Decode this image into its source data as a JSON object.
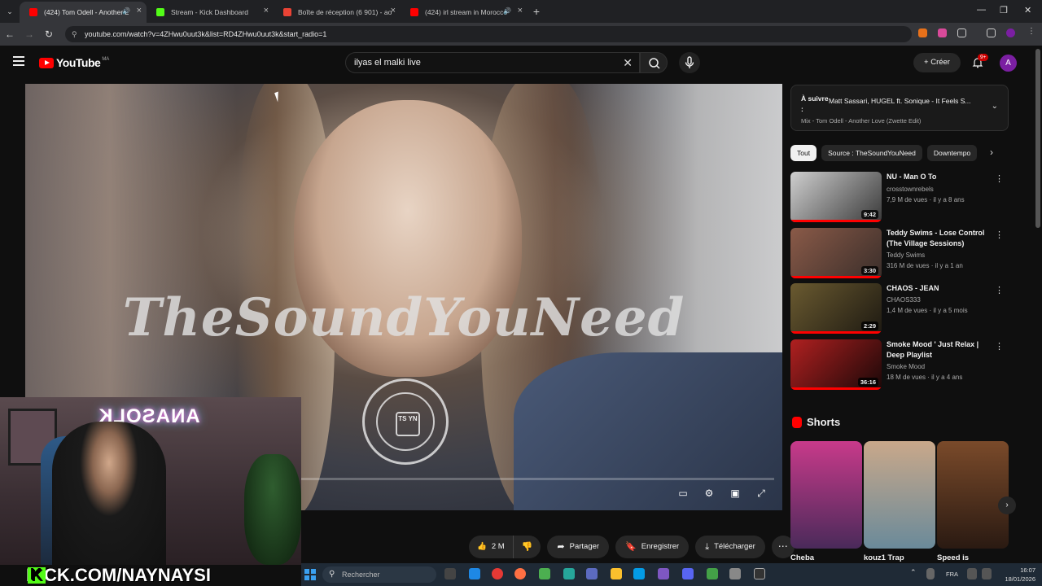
{
  "browser": {
    "tabs": [
      {
        "title": "(424) Tom Odell - Another L",
        "favicon_color": "#ff0000",
        "active": true,
        "audio": true
      },
      {
        "title": "Stream - Kick Dashboard",
        "favicon_color": "#53fc18",
        "active": false,
        "audio": false
      },
      {
        "title": "Boîte de réception (6 901) - ao",
        "favicon_color": "#ea4335",
        "active": false,
        "audio": false
      },
      {
        "title": "(424) irl stream in Morocco",
        "favicon_color": "#ff0000",
        "active": false,
        "audio": true
      }
    ],
    "url": "youtube.com/watch?v=4ZHwu0uut3k&list=RD4ZHwu0uut3k&start_radio=1",
    "new_tab_icon": "plus-icon"
  },
  "youtube": {
    "logo_text": "YouTube",
    "country_code": "MA",
    "search_value": "ilyas el malki live",
    "create_label": "Créer",
    "notif_badge": "9+",
    "avatar_letter": "A"
  },
  "player": {
    "watermark": "TheSoundYouNeed",
    "emblem_text": "TS YN"
  },
  "actions": {
    "likes": "2 M",
    "share": "Partager",
    "save": "Enregistrer",
    "download": "Télécharger"
  },
  "up_next": {
    "label": "À suivre :",
    "title": "Matt Sassari, HUGEL ft. Sonique - It Feels S...",
    "subtitle": "Mix - Tom Odell - Another Love (Zwette Edit)"
  },
  "chips": [
    "Tout",
    "Source : TheSoundYouNeed",
    "Downtempo"
  ],
  "videos": [
    {
      "title": "NU - Man O To",
      "channel": "crosstownrebels",
      "meta": "7,9 M de vues · il y a 8 ans",
      "duration": "9:42",
      "progress": 1.0,
      "colors": [
        "#cfcfcf",
        "#3a3a3a"
      ]
    },
    {
      "title": "Teddy Swims - Lose Control (The Village Sessions)",
      "channel": "Teddy Swims",
      "meta": "316 M de vues · il y a 1 an",
      "duration": "3:30",
      "progress": 1.0,
      "colors": [
        "#8a5a48",
        "#3a2e2a"
      ]
    },
    {
      "title": "CHAOS - JEAN",
      "channel": "CHAOS333",
      "meta": "1,4 M de vues · il y a 5 mois",
      "duration": "2:29",
      "progress": 1.0,
      "colors": [
        "#6a5a30",
        "#1e1a12"
      ]
    },
    {
      "title": "Smoke Mood ' Just Relax | Deep Playlist",
      "channel": "Smoke Mood",
      "meta": "18 M de vues · il y a 4 ans",
      "duration": "36:16",
      "progress": 1.0,
      "colors": [
        "#b02020",
        "#1a0808"
      ]
    }
  ],
  "shorts": {
    "heading": "Shorts",
    "items": [
      {
        "title": "Cheba",
        "colors": [
          "#c83a8a",
          "#4a2a5a"
        ]
      },
      {
        "title": "kouz1 Trap",
        "colors": [
          "#c9a88a",
          "#6a8a9a"
        ]
      },
      {
        "title": "Speed is",
        "colors": [
          "#7a4a2a",
          "#2a1a12"
        ]
      }
    ]
  },
  "webcam": {
    "neon_text": "ANASOLK",
    "kick_text": "KICK.COM/NAYNAYSI",
    "kick_letter": "K"
  },
  "taskbar": {
    "search_placeholder": "Rechercher",
    "lang": "FRA",
    "time": "16:07",
    "date": "18/01/2026"
  }
}
